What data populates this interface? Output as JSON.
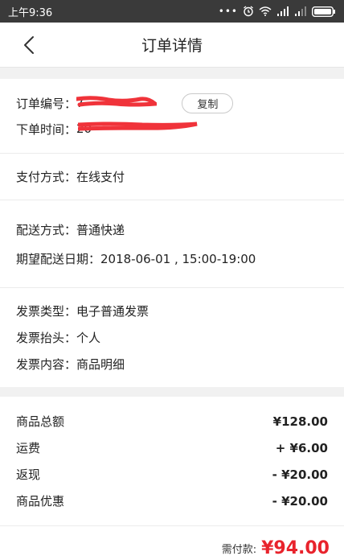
{
  "status_bar": {
    "time": "上午9:36",
    "dots": "•••",
    "battery": ""
  },
  "nav": {
    "title": "订单详情"
  },
  "order": {
    "number_label": "订单编号：",
    "number_prefix": "7",
    "copy_label": "复制",
    "time_label": "下单时间：",
    "time_prefix": "20"
  },
  "payment": {
    "method": "支付方式：在线支付"
  },
  "shipping": {
    "method": "配送方式：普通快递",
    "expected": "期望配送日期：2018-06-01 , 15:00-19:00"
  },
  "invoice": {
    "type": "发票类型：电子普通发票",
    "title": "发票抬头：个人",
    "content": "发票内容：商品明细"
  },
  "amounts": [
    {
      "label": "商品总额",
      "value": "¥128.00"
    },
    {
      "label": "运费",
      "value": "+ ¥6.00"
    },
    {
      "label": "返现",
      "value": "- ¥20.00"
    },
    {
      "label": "商品优惠",
      "value": "- ¥20.00"
    }
  ],
  "total": {
    "label": "需付款:",
    "value": "¥94.00"
  },
  "colors": {
    "accent": "#e8232c",
    "redaction": "#f0333a"
  }
}
